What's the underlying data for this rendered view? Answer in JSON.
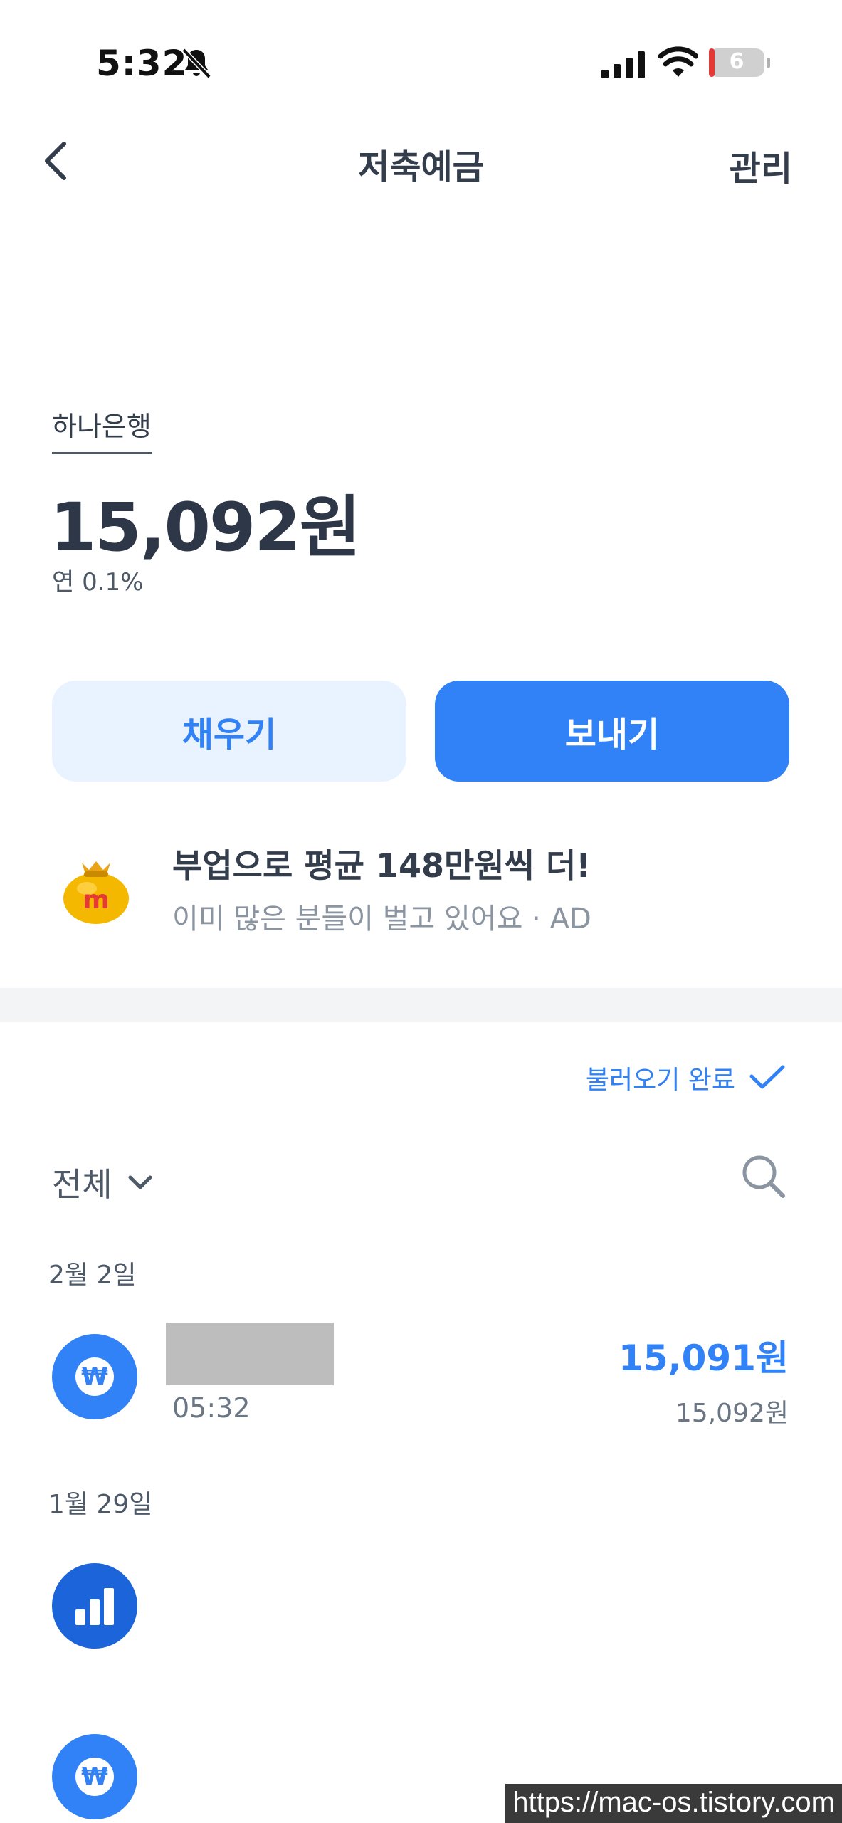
{
  "status_bar": {
    "time": "5:32",
    "battery": "6"
  },
  "nav": {
    "title": "저축예금",
    "manage": "관리"
  },
  "account": {
    "bank": "하나은행",
    "balance": "15,092원",
    "rate": "연 0.1%"
  },
  "actions": {
    "fill": "채우기",
    "send": "보내기"
  },
  "ad": {
    "title": "부업으로 평균 148만원씩 더!",
    "subtitle": "이미 많은 분들이 벌고 있어요 · AD"
  },
  "list": {
    "loaded_status": "불러오기 완료",
    "filter": "전체",
    "groups": [
      {
        "date": "2월 2일",
        "time": "05:32",
        "amount": "15,091원",
        "balance": "15,092원"
      },
      {
        "date": "1월 29일"
      }
    ]
  },
  "icons": {
    "won": "₩"
  },
  "watermark": "https://mac-os.tistory.com",
  "colors": {
    "accent": "#3182f6",
    "accent_light": "#e8f3ff",
    "dark_blue": "#1b64da"
  }
}
